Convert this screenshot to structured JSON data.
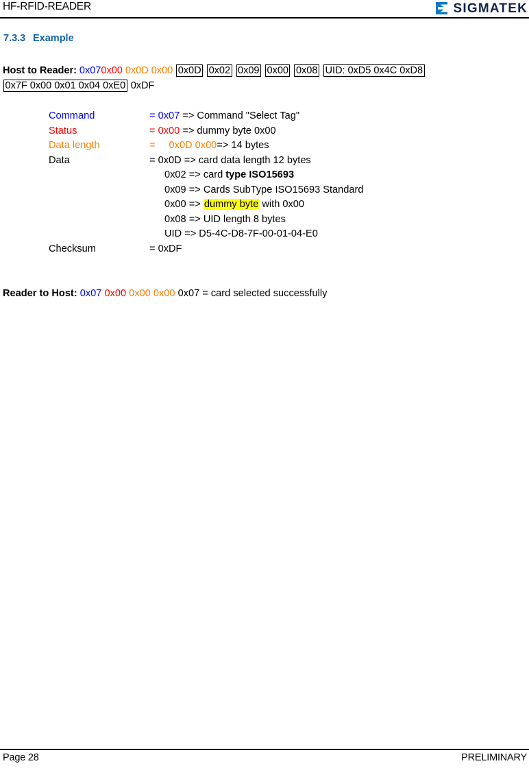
{
  "header": {
    "document_title": "HF-RFID-READER",
    "logo_text": "SIGMATEK",
    "logo_icon": "sigmatek-sigma-mark",
    "logo_color": "#0b7ac4",
    "logo_text_color": "#10234d"
  },
  "section": {
    "number": "7.3.3",
    "title": "Example",
    "color": "#1464aa"
  },
  "host_to_reader": {
    "label": "Host to Reader:",
    "command": "0x07",
    "status": "0x00",
    "data_length": "0x0D 0x00",
    "boxed_bytes": [
      "0x0D",
      "0x02",
      "0x09",
      "0x00",
      "0x08"
    ],
    "uid_box_line1": "UID: 0xD5 0x4C 0xD8",
    "uid_box_line2": "0x7F 0x00 0x01 0x04 0xE0",
    "checksum": "0xDF"
  },
  "details": {
    "rows": [
      {
        "label": "Command",
        "color": "#0000ff",
        "eq": "=",
        "value": "0x07",
        "arrow": "=>",
        "description": "Command \"Select Tag\""
      },
      {
        "label": "Status",
        "color": "#ff0000",
        "eq": "=",
        "value": "0x00",
        "arrow": "=>",
        "description": "dummy byte 0x00"
      },
      {
        "label": "Data length",
        "color": "#ff7f00",
        "eq": "=",
        "value": "0x0D 0x00",
        "arrow": "=>",
        "description": "14 bytes"
      },
      {
        "label": "Data",
        "color": "#000000",
        "eq": "=",
        "value": "0x0D",
        "arrow": "=>",
        "description": "card data length 12 bytes"
      }
    ],
    "data_sublines": [
      {
        "value": "0x02",
        "arrow": "=>",
        "text_before": "card ",
        "text_bold": "type ISO15693",
        "text_after": "",
        "highlight": ""
      },
      {
        "value": "0x09",
        "arrow": "=>",
        "text_before": "Cards SubType ISO15693 Standard",
        "text_bold": "",
        "text_after": "",
        "highlight": ""
      },
      {
        "value": "0x00",
        "arrow": "=>",
        "text_before": "",
        "text_bold": "",
        "text_after": " with 0x00",
        "highlight": "dummy byte"
      },
      {
        "value": "0x08",
        "arrow": "=>",
        "text_before": "UID length 8 bytes",
        "text_bold": "",
        "text_after": "",
        "highlight": ""
      },
      {
        "value": "UID ",
        "arrow": "=>",
        "text_before": " D5-4C-D8-7F-00-01-04-E0",
        "text_bold": "",
        "text_after": "",
        "highlight": ""
      }
    ],
    "checksum_row": {
      "label": "Checksum",
      "eq": "=",
      "value": "0xDF"
    }
  },
  "reader_to_host": {
    "label": "Reader to Host:",
    "command": "0x07",
    "status": "0x00",
    "data_length": "0x00 0x00",
    "checksum": "0x07",
    "result": "= card selected successfully"
  },
  "footer": {
    "page": "Page 28",
    "status": "PRELIMINARY"
  }
}
